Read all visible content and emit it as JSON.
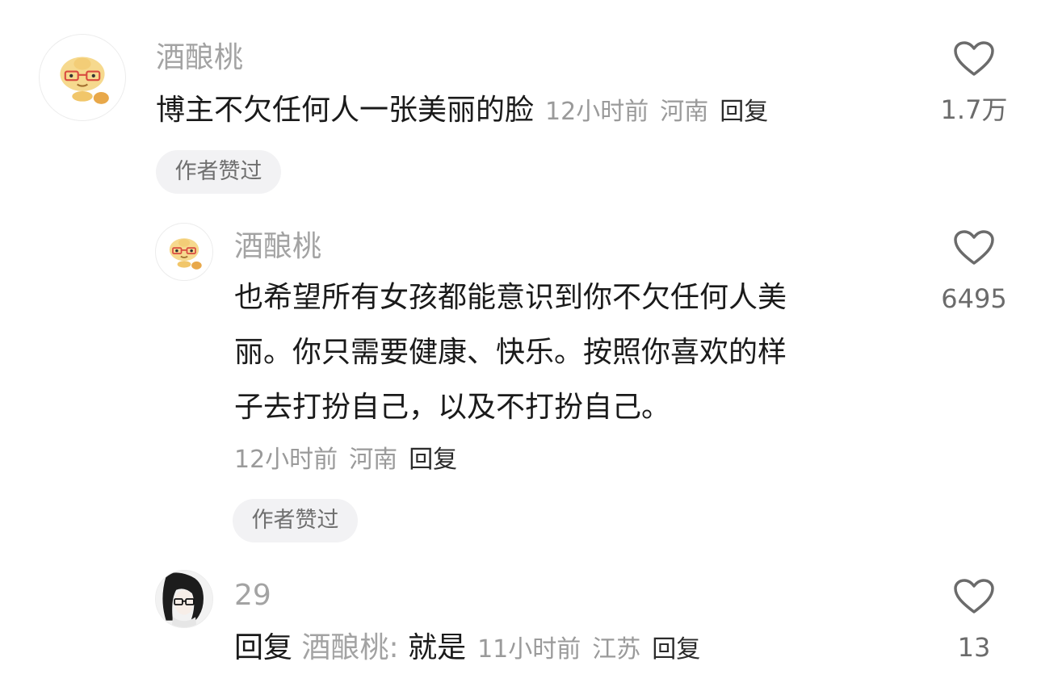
{
  "comments": [
    {
      "username": "酒酿桃",
      "text": "博主不欠任何人一张美丽的脸",
      "time": "12小时前",
      "location": "河南",
      "reply_label": "回复",
      "badge": "作者赞过",
      "likes": "1.7万",
      "avatar_icon": "cartoon-bun-with-glasses"
    },
    {
      "username": "酒酿桃",
      "text_lines": [
        "也希望所有女孩都能意识到你不欠任何人美",
        "丽。你只需要健康、快乐。按照你喜欢的样",
        "子去打扮自己，以及不打扮自己。"
      ],
      "time": "12小时前",
      "location": "河南",
      "reply_label": "回复",
      "badge": "作者赞过",
      "likes": "6495",
      "avatar_icon": "cartoon-bun-with-glasses"
    },
    {
      "username": "29",
      "reply_prefix": "回复",
      "reply_to": "酒酿桃:",
      "text": "就是",
      "time": "11小时前",
      "location": "江苏",
      "reply_label": "回复",
      "likes": "13",
      "avatar_icon": "anime-character-with-glasses"
    }
  ],
  "colors": {
    "username": "#a3a3a3",
    "text": "#1a1a1a",
    "meta": "#9a9a9a",
    "badge_bg": "#f2f2f4",
    "like_icon": "#6b6b6b"
  }
}
